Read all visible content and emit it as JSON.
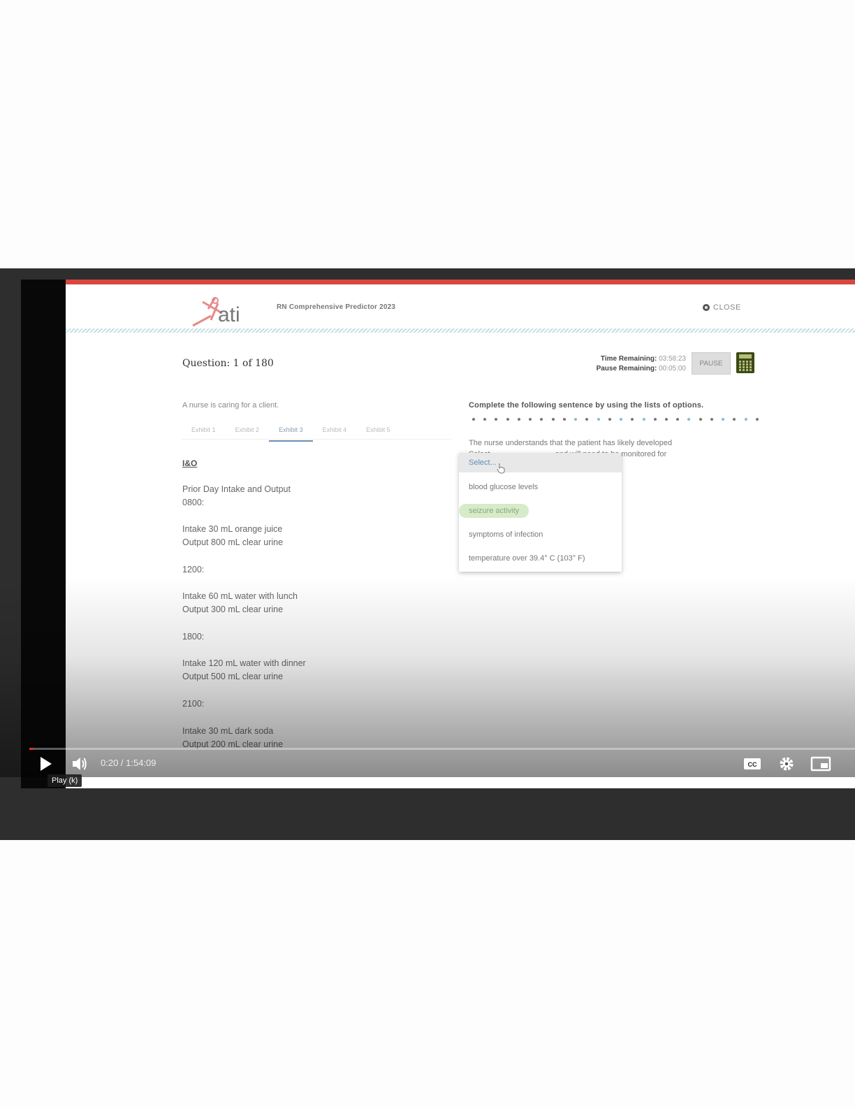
{
  "app": {
    "logo_text": "ati",
    "title": "RN Comprehensive Predictor 2023",
    "close_label": "CLOSE"
  },
  "question": {
    "label": "Question: 1 of 180",
    "time_remaining_label": "Time Remaining:",
    "time_remaining_value": "03:58:23",
    "pause_remaining_label": "Pause Remaining:",
    "pause_remaining_value": "00:05:00",
    "pause_button": "PAUSE"
  },
  "left_panel": {
    "intro": "A nurse is caring for a client.",
    "tabs": [
      "Exhibit 1",
      "Exhibit 2",
      "Exhibit 3",
      "Exhibit 4",
      "Exhibit 5"
    ],
    "active_tab": "Exhibit 3",
    "section_heading": "I&O",
    "lines": [
      "Prior Day Intake and Output",
      "0800:",
      "Intake 30 mL orange juice",
      "Output 800 mL clear urine",
      "1200:",
      "Intake 60 mL water with lunch",
      "Output 300 mL clear urine",
      "1800:",
      "Intake 120 mL water with dinner",
      "Output 500 mL clear urine",
      "2100:",
      "Intake 30 mL dark soda",
      "Output 200 mL clear urine"
    ]
  },
  "right_panel": {
    "instruction": "Complete the following sentence by using the lists of options.",
    "sentence": "The nurse understands that the patient has likely developed",
    "sentence_part2": "Select",
    "sentence_part3": "and will need to be monitored for",
    "dropdown": {
      "placeholder": "Select...",
      "options": [
        "blood glucose levels",
        "seizure activity",
        "symptoms of infection",
        "temperature over 39.4° C (103° F)"
      ],
      "highlighted": "seizure activity"
    }
  },
  "player": {
    "time_display": "0:20 / 1:54:09",
    "tooltip": "Play (k)",
    "progress_fraction": 0.003,
    "icons": [
      "play-icon",
      "volume-icon",
      "cc-icon",
      "settings-icon",
      "miniplayer-icon"
    ]
  }
}
